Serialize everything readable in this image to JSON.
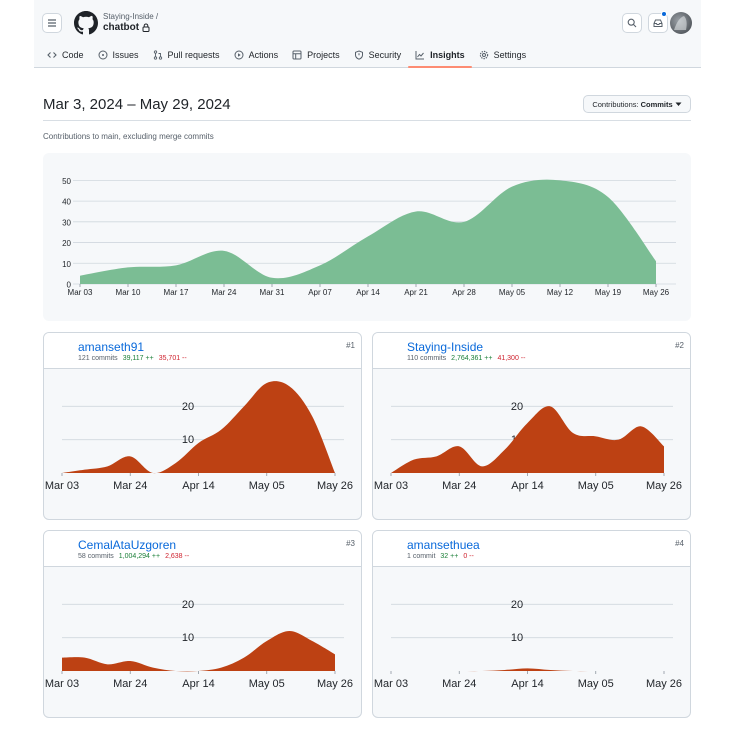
{
  "header": {
    "owner": "Staying-Inside /",
    "repo": "chatbot",
    "tabs": [
      {
        "label": "Code",
        "icon": "code-icon"
      },
      {
        "label": "Issues",
        "icon": "issue-icon"
      },
      {
        "label": "Pull requests",
        "icon": "pull-request-icon"
      },
      {
        "label": "Actions",
        "icon": "play-icon"
      },
      {
        "label": "Projects",
        "icon": "table-icon"
      },
      {
        "label": "Security",
        "icon": "shield-icon"
      },
      {
        "label": "Insights",
        "icon": "graph-icon",
        "active": true
      },
      {
        "label": "Settings",
        "icon": "gear-icon"
      }
    ]
  },
  "range": {
    "title": "Mar 3, 2024 – May 29, 2024",
    "button_prefix": "Contributions:",
    "button_value": "Commits",
    "subtitle": "Contributions to main, excluding merge commits"
  },
  "colors": {
    "main_area": "#7bbd94",
    "contributor_area": "#bd4113",
    "active_tab_underline": "#fd8c73",
    "link": "#0969da"
  },
  "chart_data": [
    {
      "type": "area",
      "x": [
        "Mar 03",
        "Mar 10",
        "Mar 17",
        "Mar 24",
        "Mar 31",
        "Apr 07",
        "Apr 14",
        "Apr 21",
        "Apr 28",
        "May 05",
        "May 12",
        "May 19",
        "May 26"
      ],
      "values": [
        4,
        8,
        9,
        16,
        3,
        9,
        23,
        35,
        30,
        47,
        50,
        42,
        11
      ],
      "yticks": [
        0,
        10,
        20,
        30,
        40,
        50
      ],
      "ylim": [
        0,
        55
      ],
      "grid": true
    },
    {
      "type": "area",
      "rank": "#1",
      "name": "amanseth91",
      "commits": "121 commits",
      "additions": "39,117 ++",
      "deletions": "35,701 --",
      "x": [
        "Mar 03",
        "Mar 10",
        "Mar 17",
        "Mar 24",
        "Mar 31",
        "Apr 07",
        "Apr 14",
        "Apr 21",
        "Apr 28",
        "May 05",
        "May 12",
        "May 19",
        "May 26"
      ],
      "xticks": [
        "Mar 03",
        "Mar 24",
        "Apr 14",
        "May 05",
        "May 26"
      ],
      "values": [
        0,
        1,
        2,
        5,
        0,
        3,
        9,
        13,
        20,
        27,
        26,
        17,
        0
      ],
      "yticks": [
        10,
        20
      ],
      "ylim": [
        0,
        30
      ]
    },
    {
      "type": "area",
      "rank": "#2",
      "name": "Staying-Inside",
      "commits": "110 commits",
      "additions": "2,764,361 ++",
      "deletions": "41,300 --",
      "x": [
        "Mar 03",
        "Mar 10",
        "Mar 17",
        "Mar 24",
        "Mar 31",
        "Apr 07",
        "Apr 14",
        "Apr 21",
        "Apr 28",
        "May 05",
        "May 12",
        "May 19",
        "May 26"
      ],
      "xticks": [
        "Mar 03",
        "Mar 24",
        "Apr 14",
        "May 05",
        "May 26"
      ],
      "values": [
        0,
        4,
        5,
        8,
        2,
        7,
        15,
        20,
        12,
        11,
        10,
        14,
        8
      ],
      "yticks": [
        10,
        20
      ],
      "ylim": [
        0,
        30
      ]
    },
    {
      "type": "area",
      "rank": "#3",
      "name": "CemalAtaUzgoren",
      "commits": "58 commits",
      "additions": "1,004,294 ++",
      "deletions": "2,638 --",
      "x": [
        "Mar 03",
        "Mar 10",
        "Mar 17",
        "Mar 24",
        "Mar 31",
        "Apr 07",
        "Apr 14",
        "Apr 21",
        "Apr 28",
        "May 05",
        "May 12",
        "May 19",
        "May 26"
      ],
      "xticks": [
        "Mar 03",
        "Mar 24",
        "Apr 14",
        "May 05",
        "May 26"
      ],
      "values": [
        4,
        4,
        2,
        3,
        1,
        0,
        0,
        1,
        4,
        9,
        12,
        9,
        5
      ],
      "yticks": [
        10,
        20
      ],
      "ylim": [
        0,
        30
      ]
    },
    {
      "type": "area",
      "rank": "#4",
      "name": "amansethuea",
      "commits": "1 commit",
      "additions": "32 ++",
      "deletions": "0 --",
      "x": [
        "Mar 03",
        "Mar 10",
        "Mar 17",
        "Mar 24",
        "Mar 31",
        "Apr 07",
        "Apr 14",
        "Apr 21",
        "Apr 28",
        "May 05",
        "May 12",
        "May 19",
        "May 26"
      ],
      "xticks": [
        "Mar 03",
        "Mar 24",
        "Apr 14",
        "May 05",
        "May 26"
      ],
      "values": [
        0,
        0,
        0,
        0,
        0,
        0.3,
        0.8,
        0.3,
        0,
        0,
        0,
        0,
        0
      ],
      "yticks": [
        10,
        20
      ],
      "ylim": [
        0,
        30
      ]
    }
  ]
}
